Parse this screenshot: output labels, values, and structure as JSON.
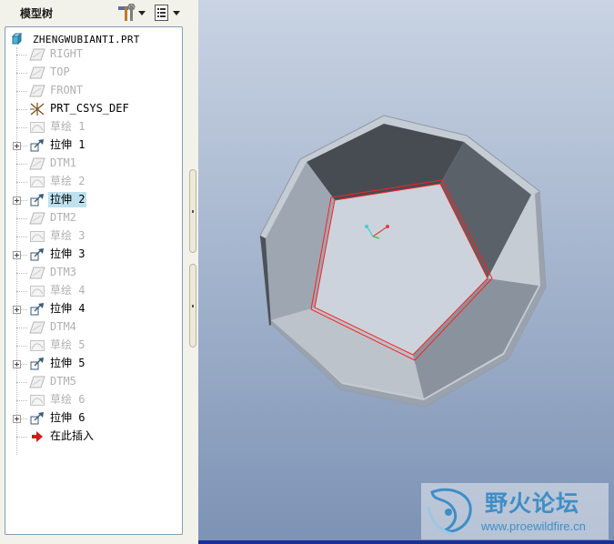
{
  "panel": {
    "title": "模型树",
    "tools_icon": "hammer-wrench-icon",
    "show_icon": "tree-list-icon"
  },
  "tree": {
    "root": {
      "label": "ZHENGWUBIANTI.PRT",
      "icon": "part-cube-icon"
    },
    "items": [
      {
        "label": "RIGHT",
        "icon": "datum-plane-icon",
        "state": "dim"
      },
      {
        "label": "TOP",
        "icon": "datum-plane-icon",
        "state": "dim"
      },
      {
        "label": "FRONT",
        "icon": "datum-plane-icon",
        "state": "dim"
      },
      {
        "label": "PRT_CSYS_DEF",
        "icon": "coordinate-system-icon",
        "state": "active"
      },
      {
        "label": "草绘 1",
        "icon": "sketch-icon",
        "state": "dim"
      },
      {
        "label": "拉伸 1",
        "icon": "extrude-icon",
        "state": "active",
        "expandable": true
      },
      {
        "label": "DTM1",
        "icon": "datum-plane-icon",
        "state": "dim"
      },
      {
        "label": "草绘 2",
        "icon": "sketch-icon",
        "state": "dim"
      },
      {
        "label": "拉伸 2",
        "icon": "extrude-icon",
        "state": "active",
        "expandable": true,
        "selected": true
      },
      {
        "label": "DTM2",
        "icon": "datum-plane-icon",
        "state": "dim"
      },
      {
        "label": "草绘 3",
        "icon": "sketch-icon",
        "state": "dim"
      },
      {
        "label": "拉伸 3",
        "icon": "extrude-icon",
        "state": "active",
        "expandable": true
      },
      {
        "label": "DTM3",
        "icon": "datum-plane-icon",
        "state": "dim"
      },
      {
        "label": "草绘 4",
        "icon": "sketch-icon",
        "state": "dim"
      },
      {
        "label": "拉伸 4",
        "icon": "extrude-icon",
        "state": "active",
        "expandable": true
      },
      {
        "label": "DTM4",
        "icon": "datum-plane-icon",
        "state": "dim"
      },
      {
        "label": "草绘 5",
        "icon": "sketch-icon",
        "state": "dim"
      },
      {
        "label": "拉伸 5",
        "icon": "extrude-icon",
        "state": "active",
        "expandable": true
      },
      {
        "label": "DTM5",
        "icon": "datum-plane-icon",
        "state": "dim"
      },
      {
        "label": "草绘 6",
        "icon": "sketch-icon",
        "state": "dim"
      },
      {
        "label": "拉伸 6",
        "icon": "extrude-icon",
        "state": "active",
        "expandable": true
      },
      {
        "label": "在此插入",
        "icon": "insert-here-arrow-icon",
        "state": "active"
      }
    ]
  },
  "viewport": {
    "model": "dodecahedron-shell-model",
    "highlight_color": "#ff2020"
  },
  "watermark": {
    "name_cn": "野火论坛",
    "url": "www.proewildfire.cn"
  }
}
